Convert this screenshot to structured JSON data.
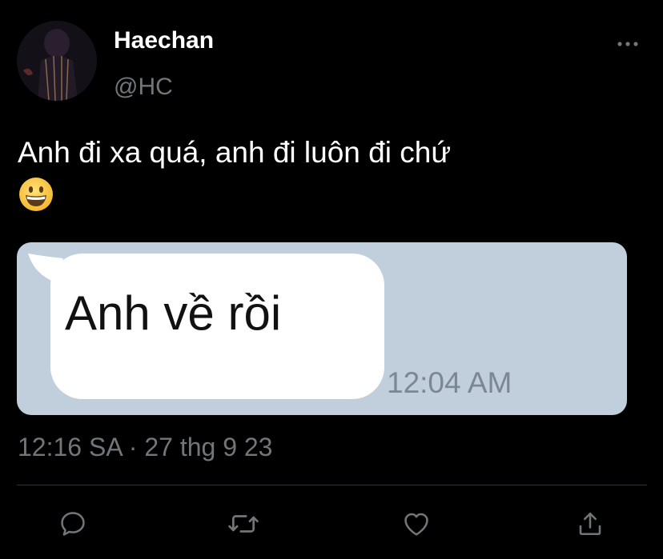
{
  "author": {
    "name": "Haechan",
    "handle": "@HC",
    "avatar_icon": "profile-photo"
  },
  "tweet": {
    "text": "Anh đi xa quá, anh đi luôn đi chứ",
    "emoji_icon": "grinning-face-emoji"
  },
  "media": {
    "message_text": "Anh về rồi",
    "message_time": "12:04 AM",
    "background": "#c1cedb"
  },
  "meta": {
    "timestamp": "12:16 SA · 27 thg 9 23"
  },
  "actions": [
    {
      "name": "reply",
      "icon": "reply-icon"
    },
    {
      "name": "retweet",
      "icon": "retweet-icon"
    },
    {
      "name": "like",
      "icon": "heart-icon"
    },
    {
      "name": "share",
      "icon": "share-icon"
    }
  ],
  "colors": {
    "background": "#000000",
    "text": "#ffffff",
    "secondary": "#71767b",
    "divider": "#2f3336"
  }
}
